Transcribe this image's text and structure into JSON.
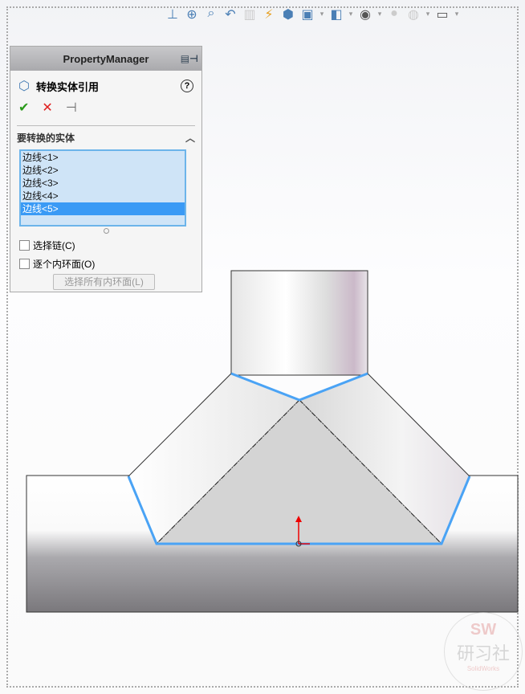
{
  "property_manager": {
    "header": "PropertyManager",
    "title": "转换实体引用",
    "help": "?",
    "section_title": "要转换的实体",
    "entities": [
      "边线<1>",
      "边线<2>",
      "边线<3>",
      "边线<4>",
      "边线<5>"
    ],
    "selected_index": 4,
    "checkbox_chain": "选择链(C)",
    "checkbox_inner_loops": "逐个内环面(O)",
    "select_all_inner_button": "选择所有内环面(L)"
  },
  "toolbar_icons": [
    "normal-to-icon",
    "zoom-to-fit-icon",
    "zoom-to-area-icon",
    "previous-view-icon",
    "section-view-icon",
    "dynamic-annotation-icon",
    "view-orientation-icon",
    "display-style-icon",
    "hide-show-icon",
    "edit-appearance-icon",
    "apply-scene-icon",
    "view-settings-icon"
  ],
  "watermark": {
    "line1": "SW",
    "line2": "研习社",
    "line3": "SolidWorks"
  },
  "colors": {
    "edge_selected": "#4aa3f5",
    "list_selected": "#3a9af5",
    "origin": "#e00000"
  }
}
